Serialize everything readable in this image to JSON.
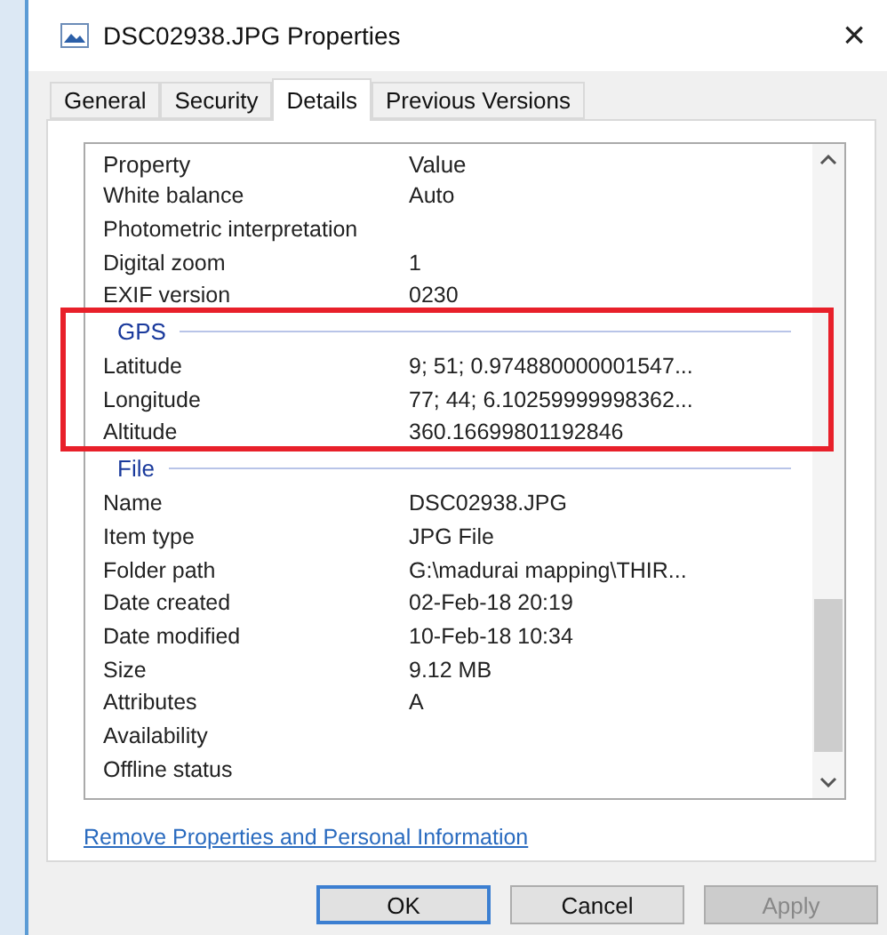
{
  "window": {
    "title": "DSC02938.JPG Properties",
    "close": "×"
  },
  "tabs": [
    {
      "label": "General",
      "selected": false
    },
    {
      "label": "Security",
      "selected": false
    },
    {
      "label": "Details",
      "selected": true
    },
    {
      "label": "Previous Versions",
      "selected": false
    }
  ],
  "table": {
    "columns": [
      "Property",
      "Value"
    ],
    "groups": [
      {
        "rows": [
          [
            "White balance",
            "Auto"
          ],
          [
            "Photometric interpretation",
            ""
          ],
          [
            "Digital zoom",
            "1"
          ],
          [
            "EXIF version",
            "0230"
          ]
        ]
      },
      {
        "name": "GPS",
        "highlighted": true,
        "rows": [
          [
            "Latitude",
            "9; 51; 0.974880000001547..."
          ],
          [
            "Longitude",
            "77; 44; 6.10259999998362..."
          ],
          [
            "Altitude",
            "360.16699801192846"
          ]
        ]
      },
      {
        "name": "File",
        "highlighted": false,
        "rows": [
          [
            "Name",
            "DSC02938.JPG"
          ],
          [
            "Item type",
            "JPG File"
          ],
          [
            "Folder path",
            "G:\\madurai mapping\\THIR..."
          ],
          [
            "Date created",
            "02-Feb-18 20:19"
          ],
          [
            "Date modified",
            "10-Feb-18 10:34"
          ],
          [
            "Size",
            "9.12 MB"
          ],
          [
            "Attributes",
            "A"
          ],
          [
            "Availability",
            ""
          ],
          [
            "Offline status",
            ""
          ]
        ]
      }
    ]
  },
  "link": "Remove Properties and Personal Information",
  "buttons": [
    {
      "label": "OK",
      "default": true,
      "disabled": false
    },
    {
      "label": "Cancel",
      "default": false,
      "disabled": false
    },
    {
      "label": "Apply",
      "default": false,
      "disabled": true
    }
  ]
}
